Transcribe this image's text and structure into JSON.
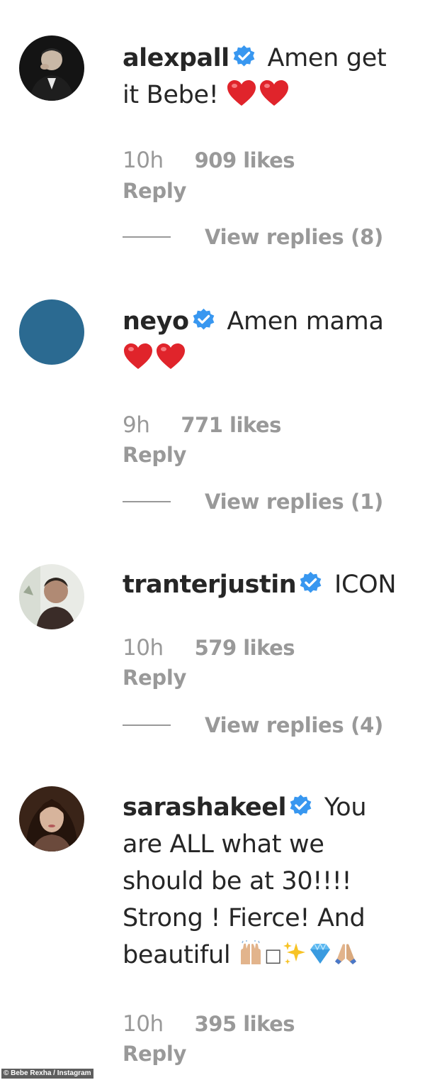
{
  "colors": {
    "text": "#262626",
    "meta": "#999999",
    "verified": "#3897f0",
    "heart": "#e0242b",
    "neyo_avatar": "#2b6a91"
  },
  "comments": [
    {
      "username": "alexpall",
      "text_parts": [
        "Amen get",
        "it Bebe!"
      ],
      "emoji": [
        "red-heart",
        "red-heart"
      ],
      "time": "10h",
      "likes": "909 likes",
      "reply": "Reply",
      "view_replies": "View replies (8)"
    },
    {
      "username": "neyo",
      "text_parts": [
        "Amen mama"
      ],
      "emoji": [
        "red-heart",
        "red-heart"
      ],
      "time": "9h",
      "likes": "771 likes",
      "reply": "Reply",
      "view_replies": "View replies (1)"
    },
    {
      "username": "tranterjustin",
      "text_parts": [
        "ICON"
      ],
      "time": "10h",
      "likes": "579 likes",
      "reply": "Reply",
      "view_replies": "View replies (4)"
    },
    {
      "username": "sarashakeel",
      "text_parts": [
        "You",
        "are ALL what we",
        "should be at 30!!!!",
        "Strong ! Fierce! And",
        "beautiful"
      ],
      "emoji": [
        "raising-hands",
        "missing-glyph",
        "sparkles",
        "gem",
        "folded-hands"
      ],
      "missing_glyph": "□",
      "time": "10h",
      "likes": "395 likes",
      "reply": "Reply"
    }
  ],
  "credit": "© Bebe Rexha / Instagram"
}
